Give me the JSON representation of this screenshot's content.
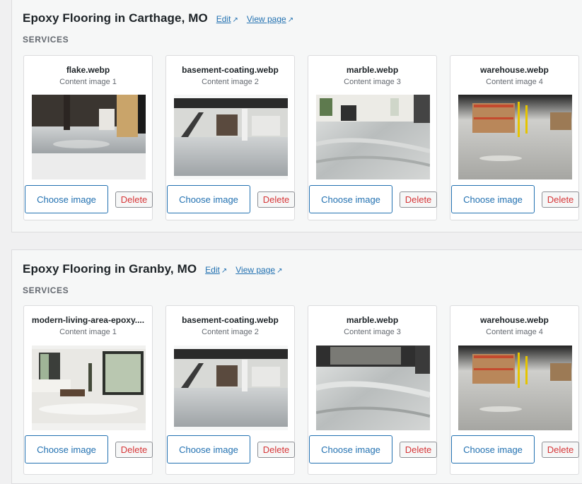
{
  "sections": [
    {
      "title": "Epoxy Flooring in Carthage, MO",
      "edit_label": "Edit",
      "view_label": "View page",
      "ext_icon": "↗",
      "group_label": "SERVICES",
      "cards": [
        {
          "filename": "flake.webp",
          "subtitle": "Content image 1",
          "choose_label": "Choose image",
          "delete_label": "Delete"
        },
        {
          "filename": "basement-coating.webp",
          "subtitle": "Content image 2",
          "choose_label": "Choose image",
          "delete_label": "Delete"
        },
        {
          "filename": "marble.webp",
          "subtitle": "Content image 3",
          "choose_label": "Choose image",
          "delete_label": "Delete"
        },
        {
          "filename": "warehouse.webp",
          "subtitle": "Content image 4",
          "choose_label": "Choose image",
          "delete_label": "Delete"
        }
      ]
    },
    {
      "title": "Epoxy Flooring in Granby, MO",
      "edit_label": "Edit",
      "view_label": "View page",
      "ext_icon": "↗",
      "group_label": "SERVICES",
      "cards": [
        {
          "filename": "modern-living-area-epoxy....",
          "subtitle": "Content image 1",
          "choose_label": "Choose image",
          "delete_label": "Delete"
        },
        {
          "filename": "basement-coating.webp",
          "subtitle": "Content image 2",
          "choose_label": "Choose image",
          "delete_label": "Delete"
        },
        {
          "filename": "marble.webp",
          "subtitle": "Content image 3",
          "choose_label": "Choose image",
          "delete_label": "Delete"
        },
        {
          "filename": "warehouse.webp",
          "subtitle": "Content image 4",
          "choose_label": "Choose image",
          "delete_label": "Delete"
        }
      ]
    }
  ],
  "colors": {
    "link": "#2271b1",
    "delete_text": "#d63638",
    "panel_bg": "#f6f7f7",
    "card_border": "#dcdcde"
  }
}
